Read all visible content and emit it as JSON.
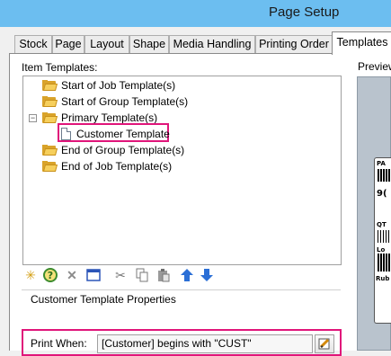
{
  "window": {
    "title": "Page Setup"
  },
  "tabs": [
    {
      "label": "Stock"
    },
    {
      "label": "Page"
    },
    {
      "label": "Layout"
    },
    {
      "label": "Shape"
    },
    {
      "label": "Media Handling"
    },
    {
      "label": "Printing Order"
    },
    {
      "label": "Templates",
      "active": true
    }
  ],
  "item_templates": {
    "label": "Item Templates:",
    "nodes": [
      {
        "label": "Start of Job Template(s)",
        "icon": "folder-icon"
      },
      {
        "label": "Start of Group Template(s)",
        "icon": "folder-icon"
      },
      {
        "label": "Primary Template(s)",
        "icon": "folder-icon",
        "expanded": true,
        "expander_glyph": "−"
      },
      {
        "label": "Customer Template",
        "icon": "document-icon",
        "selected": true
      },
      {
        "label": "End of Group Template(s)",
        "icon": "folder-icon"
      },
      {
        "label": "End of Job Template(s)",
        "icon": "folder-icon"
      }
    ]
  },
  "toolbar": {
    "buttons": [
      {
        "name": "new-template",
        "icon": "new-star-icon"
      },
      {
        "name": "wizard",
        "icon": "help-wizard-icon"
      },
      {
        "name": "delete",
        "icon": "delete-x-icon"
      },
      {
        "name": "properties",
        "icon": "window-properties-icon"
      },
      {
        "name": "cut",
        "icon": "scissors-icon"
      },
      {
        "name": "copy",
        "icon": "copy-icon"
      },
      {
        "name": "paste",
        "icon": "paste-icon"
      },
      {
        "name": "move-up",
        "icon": "arrow-up-icon"
      },
      {
        "name": "move-down",
        "icon": "arrow-down-icon"
      }
    ]
  },
  "properties": {
    "group_label": "Customer Template Properties",
    "print_when_label": "Print When:",
    "print_when_value": "[Customer] begins with \"CUST\""
  },
  "preview": {
    "label": "Preview",
    "label_fragments": [
      "PA",
      "9(",
      "QT",
      "Lo",
      "Rub"
    ]
  },
  "colors": {
    "title_bar": "#6cbef0",
    "highlight": "#e0157a",
    "folder": "#f6cf5c",
    "arrow": "#2b6fd6"
  }
}
